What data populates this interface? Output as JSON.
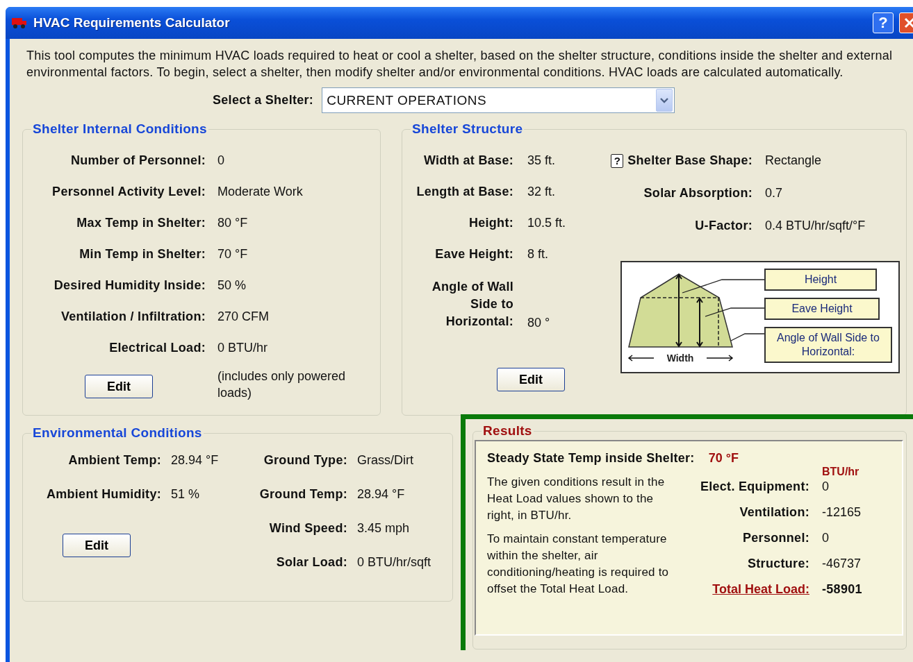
{
  "window": {
    "title": "HVAC Requirements Calculator",
    "help_button": "?"
  },
  "intro": "This tool computes the minimum HVAC loads required to heat or cool a shelter, based on the shelter structure, conditions inside the shelter and external environmental factors.  To begin, select a shelter, then modify shelter and/or environmental conditions.  HVAC loads are calculated automatically.",
  "shelter_select": {
    "label": "Select a Shelter:",
    "value": "CURRENT OPERATIONS"
  },
  "internal_conditions": {
    "title": "Shelter Internal Conditions",
    "fields": [
      {
        "label": "Number of Personnel:",
        "value": "0"
      },
      {
        "label": "Personnel Activity Level:",
        "value": "Moderate Work"
      },
      {
        "label": "Max Temp in Shelter:",
        "value": "80 °F"
      },
      {
        "label": "Min Temp in Shelter:",
        "value": "70 °F"
      },
      {
        "label": "Desired Humidity Inside:",
        "value": "50 %"
      },
      {
        "label": "Ventilation / Infiltration:",
        "value": "270 CFM"
      },
      {
        "label": "Electrical Load:",
        "value": "0 BTU/hr"
      }
    ],
    "note": "(includes only powered loads)",
    "edit_button": "Edit"
  },
  "structure": {
    "title": "Shelter Structure",
    "fields_left": [
      {
        "label": "Width at Base:",
        "value": "35 ft."
      },
      {
        "label": "Length at Base:",
        "value": "32 ft."
      },
      {
        "label": "Height:",
        "value": "10.5 ft."
      },
      {
        "label": "Eave Height:",
        "value": "8 ft."
      },
      {
        "label": "Angle of Wall Side to Horizontal:",
        "value": "80 °"
      }
    ],
    "fields_right": [
      {
        "label": "Shelter Base Shape:",
        "value": "Rectangle",
        "help": "?"
      },
      {
        "label": "Solar Absorption:",
        "value": "0.7"
      },
      {
        "label": "U-Factor:",
        "value": "0.4 BTU/hr/sqft/°F"
      }
    ],
    "diagram": {
      "width_label": "Width",
      "labels": [
        "Height",
        "Eave Height",
        "Angle of Wall Side to Horizontal:"
      ]
    },
    "edit_button": "Edit"
  },
  "environmental": {
    "title": "Environmental Conditions",
    "fields": [
      {
        "label": "Ambient Temp:",
        "value": "28.94 °F"
      },
      {
        "label": "Ground Type:",
        "value": "Grass/Dirt"
      },
      {
        "label": "Ambient Humidity:",
        "value": "51 %"
      },
      {
        "label": "Ground Temp:",
        "value": "28.94 °F"
      },
      {
        "label": "Wind Speed:",
        "value": "3.45 mph"
      },
      {
        "label": "Solar Load:",
        "value": "0 BTU/hr/sqft"
      }
    ],
    "edit_button": "Edit"
  },
  "results": {
    "title": "Results",
    "steady_state": {
      "label": "Steady State Temp inside Shelter:",
      "value": "70 °F"
    },
    "paragraphs": [
      "The given conditions result in the Heat Load values shown to the right, in BTU/hr.",
      "To maintain constant temperature within the shelter, air conditioning/heating is required to offset the Total Heat Load."
    ],
    "unit": "BTU/hr",
    "loads": [
      {
        "label": "Elect. Equipment:",
        "value": "0"
      },
      {
        "label": "Ventilation:",
        "value": "-12165"
      },
      {
        "label": "Personnel:",
        "value": "0"
      },
      {
        "label": "Structure:",
        "value": "-46737"
      }
    ],
    "total": {
      "label": "Total Heat Load:",
      "value": "-58901"
    }
  }
}
